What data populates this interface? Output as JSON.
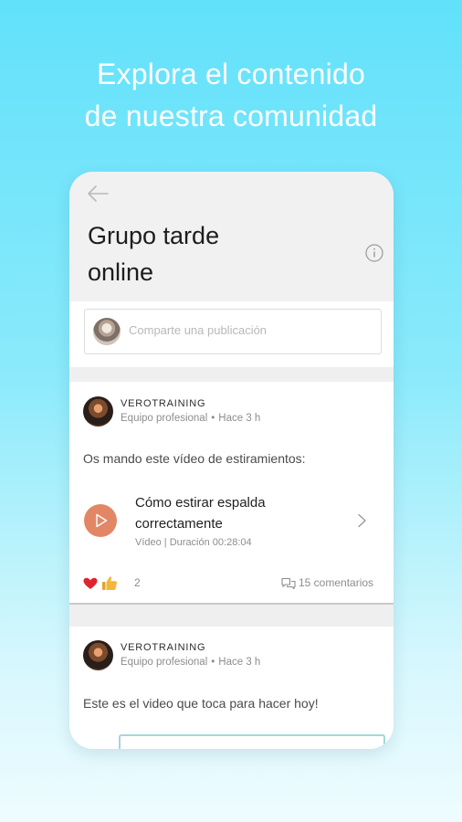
{
  "hero": {
    "line1": "Explora el contenido",
    "line2": "de nuestra comunidad"
  },
  "screen": {
    "title_line1": "Grupo tarde",
    "title_line2": "online",
    "back_icon": "arrow-left-icon",
    "info_icon": "info-icon",
    "composer": {
      "placeholder": "Comparte una publicación"
    },
    "posts": [
      {
        "author": "VEROTRAINING",
        "role": "Equipo profesional",
        "separator": "•",
        "time": "Hace 3 h",
        "text": "Os mando este vídeo de estiramientos:",
        "attachment": {
          "title_line1": "Cómo estirar espalda",
          "title_line2": "correctamente",
          "meta": "Vídeo | Duración 00:28:04",
          "icon": "play-icon"
        },
        "reactions": {
          "icons": [
            "heart-icon",
            "thumbs-up-icon"
          ],
          "count": "2"
        },
        "comments": "15 comentarios"
      },
      {
        "author": "VEROTRAINING",
        "role": "Equipo profesional",
        "separator": "•",
        "time": "Hace 3 h",
        "text": "Este es el video que toca para hacer hoy!"
      }
    ]
  },
  "colors": {
    "accent_play": "#e28766",
    "heart": "#e0242f",
    "thumb": "#f4b73a",
    "bg_top": "#62e1fb"
  }
}
